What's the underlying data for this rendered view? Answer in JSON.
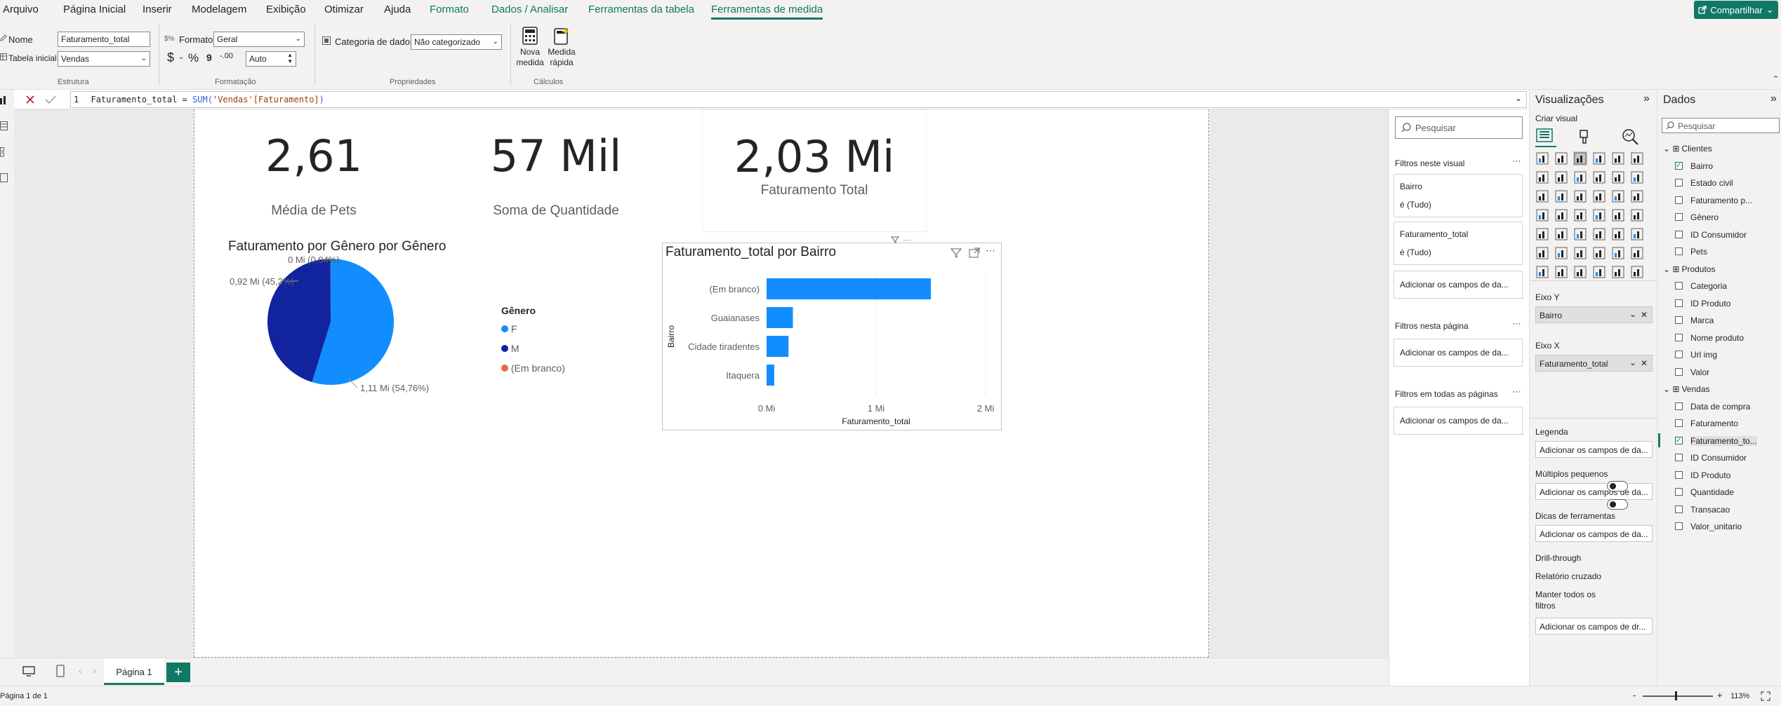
{
  "menu": {
    "items": [
      "Arquivo",
      "Página Inicial",
      "Inserir",
      "Modelagem",
      "Exibição",
      "Otimizar",
      "Ajuda"
    ],
    "context_tabs": [
      "Formato",
      "Dados / Analisar",
      "Ferramentas da tabela",
      "Ferramentas de medida"
    ],
    "share_label": "Compartilhar"
  },
  "ribbon": {
    "nome_label": "Nome",
    "nome_value": "Faturamento_total",
    "tabela_label": "Tabela inicial",
    "tabela_value": "Vendas",
    "estrutura_group": "Estrutura",
    "formato_label": "Formato",
    "formato_value": "Geral",
    "currency_symbol": "$",
    "percent_symbol": "%",
    "comma_symbol": "9",
    "decimal_symbol": "-.00",
    "decimal_value": "Auto",
    "formatacao_group": "Formatação",
    "categoria_label": "Categoria de dados",
    "categoria_value": "Não categorizado",
    "propriedades_group": "Propriedades",
    "nova_medida_line1": "Nova",
    "nova_medida_line2": "medida",
    "medida_rapida_line1": "Medida",
    "medida_rapida_line2": "rápida",
    "calculos_group": "Cálculos"
  },
  "formula": {
    "line_number": "1",
    "measure_name": "Faturamento_total",
    "operator": "=",
    "function": "SUM",
    "argument": "'Vendas'[Faturamento]"
  },
  "cards": [
    {
      "value": "2,61",
      "label": "Média de Pets"
    },
    {
      "value": "57 Mil",
      "label": "Soma de Quantidade"
    },
    {
      "value": "2,03 Mi",
      "label": "Faturamento Total"
    }
  ],
  "pie": {
    "title": "Faturamento por Gênero por Gênero",
    "legend_title": "Gênero",
    "label_top": "0 Mi (0,04%)",
    "label_left": "0,92 Mi (45,2%)",
    "label_right": "1,11 Mi (54,76%)"
  },
  "bar": {
    "title": "Faturamento_total por Bairro"
  },
  "chart_data": [
    {
      "type": "pie",
      "title": "Faturamento por Gênero por Gênero",
      "legend_title": "Gênero",
      "slices": [
        {
          "name": "F",
          "value": 1.11,
          "percent": 54.76,
          "color": "#118dff"
        },
        {
          "name": "M",
          "value": 0.92,
          "percent": 45.2,
          "color": "#12239e"
        },
        {
          "name": "(Em branco)",
          "value": 0.0,
          "percent": 0.04,
          "color": "#e66c37"
        }
      ],
      "legend_placement": "right"
    },
    {
      "type": "bar",
      "orientation": "horizontal",
      "title": "Faturamento_total por Bairro",
      "xlabel": "Faturamento_total",
      "ylabel": "Bairro",
      "categories": [
        "(Em branco)",
        "Guaianases",
        "Cidade tiradentes",
        "Itaquera"
      ],
      "values": [
        1.5,
        0.24,
        0.2,
        0.07
      ],
      "xlim": [
        0,
        2
      ],
      "x_ticks": [
        "0 Mi",
        "1 Mi",
        "2 Mi"
      ],
      "color": "#118dff",
      "grid": true
    }
  ],
  "filters": {
    "search_placeholder": "Pesquisar",
    "this_visual": "Filtros neste visual",
    "filter1_field": "Bairro",
    "filter1_value": "é (Tudo)",
    "filter2_field": "Faturamento_total",
    "filter2_value": "é (Tudo)",
    "add_fields": "Adicionar os campos de da...",
    "this_page": "Filtros nesta página",
    "all_pages": "Filtros em todas as páginas"
  },
  "viz": {
    "title": "Visualizações",
    "build_visual": "Criar visual",
    "eixo_y": "Eixo Y",
    "eixo_y_value": "Bairro",
    "eixo_x": "Eixo X",
    "eixo_x_value": "Faturamento_total",
    "legenda": "Legenda",
    "multiplos": "Múltiplos pequenos",
    "dicas": "Dicas de ferramentas",
    "add_fields": "Adicionar os campos de da...",
    "drill": "Drill-through",
    "relatorio": "Relatório cruzado",
    "manter_line1": "Manter todos os",
    "manter_line2": "filtros",
    "add_drill": "Adicionar os campos de dr..."
  },
  "data_pane": {
    "title": "Dados",
    "search_placeholder": "Pesquisar",
    "tables": [
      {
        "name": "Clientes",
        "fields": [
          "Bairro",
          "Estado civil",
          "Faturamento p...",
          "Gênero",
          "ID Consumidor",
          "Pets"
        ]
      },
      {
        "name": "Produtos",
        "fields": [
          "Categoria",
          "ID Produto",
          "Marca",
          "Nome produto",
          "Url img",
          "Valor"
        ]
      },
      {
        "name": "Vendas",
        "fields": [
          "Data de compra",
          "Faturamento",
          "Faturamento_to...",
          "ID Consumidor",
          "ID Produto",
          "Quantidade",
          "Transacao",
          "Valor_unitario"
        ]
      }
    ]
  },
  "tabs": {
    "page1": "Página 1",
    "add": "+"
  },
  "status": {
    "page_info": "Página 1 de 1",
    "zoom": "113%"
  }
}
